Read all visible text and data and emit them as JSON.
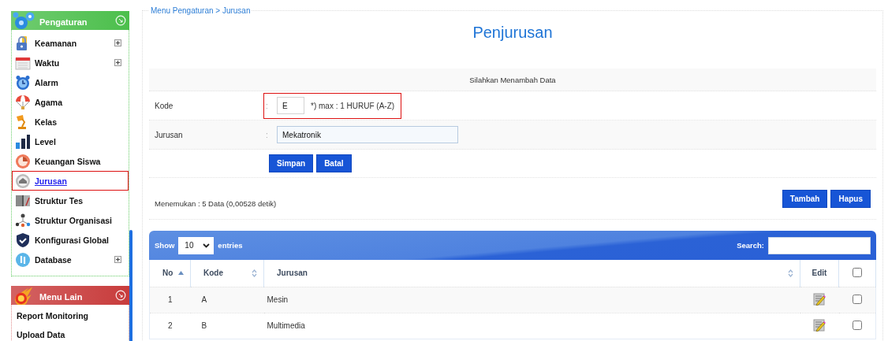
{
  "sidebar": {
    "sections": [
      {
        "title": "Pengaturan",
        "color": "#4cbf4c",
        "items": [
          {
            "label": "Keamanan",
            "expandable": true,
            "selected": false
          },
          {
            "label": "Waktu",
            "expandable": true,
            "selected": false
          },
          {
            "label": "Alarm",
            "expandable": false,
            "selected": false
          },
          {
            "label": "Agama",
            "expandable": false,
            "selected": false
          },
          {
            "label": "Kelas",
            "expandable": false,
            "selected": false
          },
          {
            "label": "Level",
            "expandable": false,
            "selected": false
          },
          {
            "label": "Keuangan Siswa",
            "expandable": false,
            "selected": false
          },
          {
            "label": "Jurusan",
            "expandable": false,
            "selected": true
          },
          {
            "label": "Struktur Tes",
            "expandable": false,
            "selected": false
          },
          {
            "label": "Struktur Organisasi",
            "expandable": false,
            "selected": false
          },
          {
            "label": "Konfigurasi Global",
            "expandable": false,
            "selected": false
          },
          {
            "label": "Database",
            "expandable": true,
            "selected": false
          }
        ]
      },
      {
        "title": "Menu Lain",
        "color": "#c83c3c",
        "items": [
          {
            "label": "Report Monitoring",
            "expandable": false,
            "selected": false
          },
          {
            "label": "Upload Data",
            "expandable": false,
            "selected": false
          }
        ]
      }
    ]
  },
  "breadcrumb": "Menu Pengaturan > Jurusan",
  "title": "Penjurusan",
  "form": {
    "heading": "Silahkan Menambah Data",
    "fields": [
      {
        "label": "Kode",
        "separator": ":",
        "value": "E",
        "hint": "*) max : 1 HURUF (A-Z)",
        "highlighted": true,
        "kind": "short"
      },
      {
        "label": "Jurusan",
        "separator": ":",
        "value": "Mekatronik",
        "highlighted": false,
        "kind": "wide"
      }
    ],
    "buttons": [
      "Simpan",
      "Batal"
    ]
  },
  "result": {
    "summary": "Menemukan : 5 Data (0,00528 detik)",
    "buttons": [
      "Tambah",
      "Hapus"
    ]
  },
  "table": {
    "length": {
      "before": "Show",
      "value": "10",
      "after": "entries"
    },
    "search": {
      "label": "Search:"
    },
    "columns": [
      {
        "label": "No",
        "sortable": true,
        "sorted": true
      },
      {
        "label": "Kode",
        "sortable": true,
        "sorted": false
      },
      {
        "label": "Jurusan",
        "sortable": true,
        "sorted": false
      },
      {
        "label": "Edit",
        "sortable": false,
        "sorted": false
      },
      {
        "kind": "checkbox",
        "checked": false
      }
    ],
    "rows": [
      {
        "no": "1",
        "kode": "A",
        "jurusan": "Mesin",
        "checked": false
      },
      {
        "no": "2",
        "kode": "B",
        "jurusan": "Multimedia",
        "checked": false
      }
    ]
  }
}
